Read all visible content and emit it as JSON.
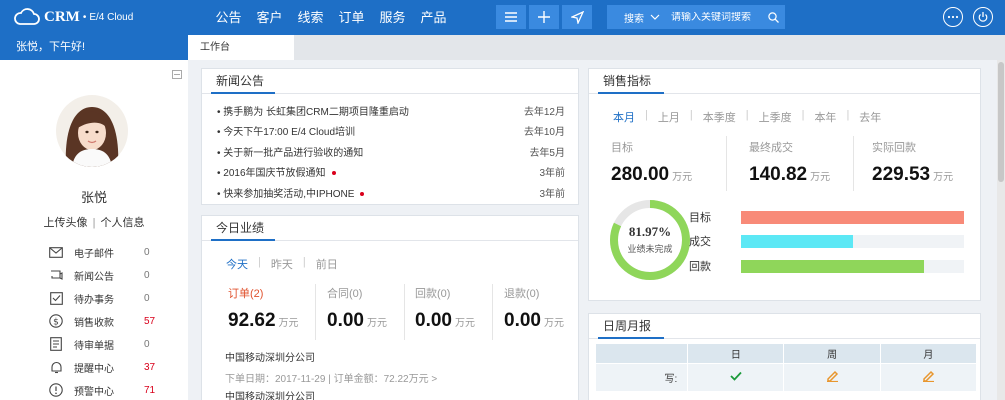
{
  "header": {
    "logo_main": "CRM",
    "logo_sub": "E/4 Cloud",
    "nav": [
      "公告",
      "客户",
      "线索",
      "订单",
      "服务",
      "产品"
    ],
    "search_label": "搜索",
    "search_placeholder": "请输入关键词搜索",
    "brand_color": "#1e6fc6",
    "icons": [
      "cloud-icon",
      "menu-icon",
      "plus-icon",
      "send-icon",
      "search-icon",
      "more-icon",
      "power-icon"
    ]
  },
  "sidebar": {
    "greeting": "张悦，下午好!",
    "name": "张悦",
    "upload_avatar": "上传头像",
    "divider": "|",
    "profile": "个人信息",
    "menu": [
      {
        "icon": "mail-icon",
        "label": "电子邮件",
        "count": "0",
        "highlight": false
      },
      {
        "icon": "news-icon",
        "label": "新闻公告",
        "count": "0",
        "highlight": false
      },
      {
        "icon": "todo-icon",
        "label": "待办事务",
        "count": "0",
        "highlight": false
      },
      {
        "icon": "dollar-icon",
        "label": "销售收款",
        "count": "57",
        "highlight": true
      },
      {
        "icon": "document-icon",
        "label": "待审单据",
        "count": "0",
        "highlight": false
      },
      {
        "icon": "bell-icon",
        "label": "提醒中心",
        "count": "37",
        "highlight": true
      },
      {
        "icon": "warning-icon",
        "label": "预警中心",
        "count": "71",
        "highlight": true
      }
    ]
  },
  "tabs": {
    "workbench": "工作台"
  },
  "news": {
    "title": "新闻公告",
    "items": [
      {
        "text": "携手鹏为 长虹集团CRM二期项目隆重启动",
        "date": "去年12月",
        "hot": false
      },
      {
        "text": "今天下午17:00 E/4 Cloud培训",
        "date": "去年10月",
        "hot": false
      },
      {
        "text": "关于新一批产品进行验收的通知",
        "date": "去年5月",
        "hot": false
      },
      {
        "text": "2016年国庆节放假通知",
        "date": "3年前",
        "hot": true
      },
      {
        "text": "快来参加抽奖活动,中IPHONE",
        "date": "3年前",
        "hot": true
      }
    ]
  },
  "performance": {
    "title": "今日业绩",
    "tabs": [
      "今天",
      "昨天",
      "前日"
    ],
    "active_tab": 0,
    "tab_sep": "|",
    "stats": [
      {
        "label": "订单(2)",
        "value": "92.62",
        "unit": "万元",
        "highlight": true
      },
      {
        "label": "合同(0)",
        "value": "0.00",
        "unit": "万元",
        "highlight": false
      },
      {
        "label": "回款(0)",
        "value": "0.00",
        "unit": "万元",
        "highlight": false
      },
      {
        "label": "退款(0)",
        "value": "0.00",
        "unit": "万元",
        "highlight": false
      }
    ],
    "orders": [
      {
        "company": "中国移动深圳分公司",
        "detail": "下单日期：2017-11-29 | 订单金额：72.22万元  >"
      },
      {
        "company": "中国移动深圳分公司"
      }
    ]
  },
  "sales": {
    "title": "销售指标",
    "tabs": [
      "本月",
      "上月",
      "本季度",
      "上季度",
      "本年",
      "去年"
    ],
    "active_tab": 0,
    "tab_sep": "|",
    "stats": [
      {
        "label": "目标",
        "value": "280.00",
        "unit": "万元"
      },
      {
        "label": "最终成交",
        "value": "140.82",
        "unit": "万元"
      },
      {
        "label": "实际回款",
        "value": "229.53",
        "unit": "万元"
      }
    ],
    "donut": {
      "percent_text": "81.97%",
      "caption": "业绩未完成",
      "fraction": 0.8197,
      "color": "#8fd65a",
      "track_color": "#e6e6e6"
    },
    "bars": [
      {
        "label": "目标",
        "fraction": 1.0,
        "color": "#f88a78"
      },
      {
        "label": "成交",
        "fraction": 0.503,
        "color": "#5ce8f5"
      },
      {
        "label": "回款",
        "fraction": 0.82,
        "color": "#8fd65a"
      }
    ]
  },
  "weekly": {
    "title": "日周月报",
    "headers": [
      "",
      "日",
      "周",
      "月"
    ],
    "rows": [
      {
        "label": "写:",
        "cells": [
          "check-icon",
          "edit-icon",
          "edit-icon"
        ]
      }
    ]
  }
}
